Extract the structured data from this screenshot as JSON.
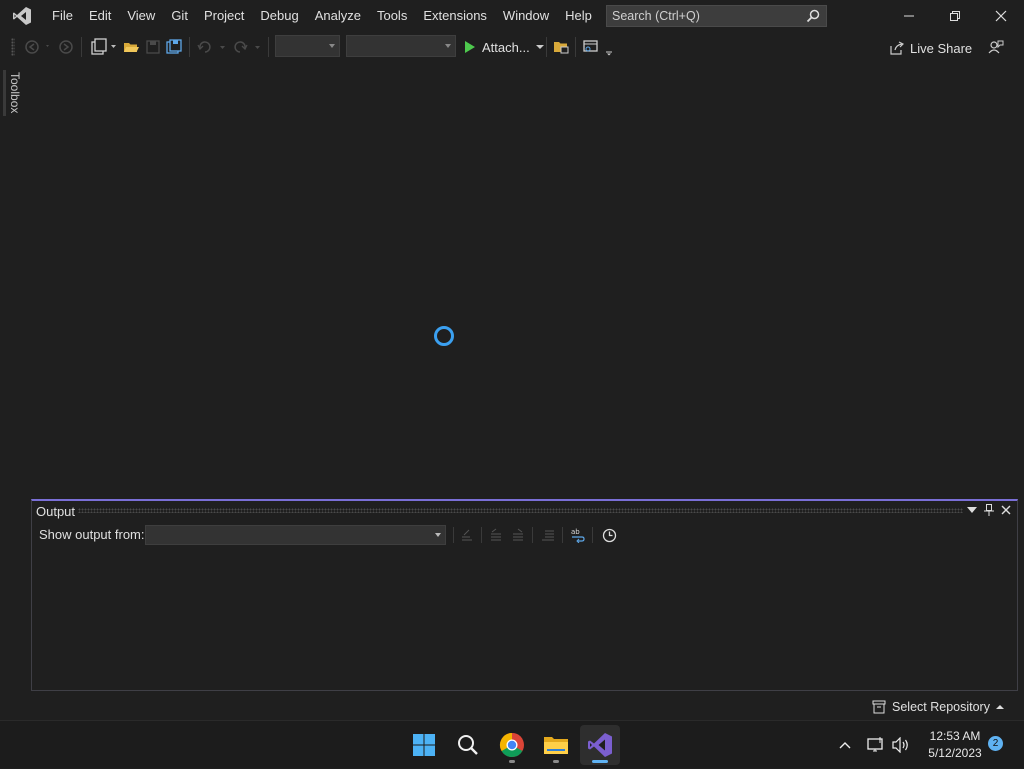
{
  "menu": {
    "items": [
      "File",
      "Edit",
      "View",
      "Git",
      "Project",
      "Debug",
      "Analyze",
      "Tools",
      "Extensions",
      "Window",
      "Help"
    ]
  },
  "search": {
    "placeholder": "Search (Ctrl+Q)"
  },
  "toolbar": {
    "attach_label": "Attach...",
    "live_share_label": "Live Share"
  },
  "toolbox": {
    "label": "Toolbox"
  },
  "output": {
    "title": "Output",
    "show_output_from_label": "Show output from:",
    "source_value": ""
  },
  "statusbar": {
    "repo_label": "Select Repository"
  },
  "taskbar": {
    "time": "12:53 AM",
    "date": "5/12/2023",
    "notification_count": "2"
  },
  "colors": {
    "background": "#1f1f1f",
    "accent": "#3ba0f0",
    "panel_border": "#7a6fd6",
    "vs_purple": "#7b5fcf",
    "run_green": "#4ec94e"
  }
}
